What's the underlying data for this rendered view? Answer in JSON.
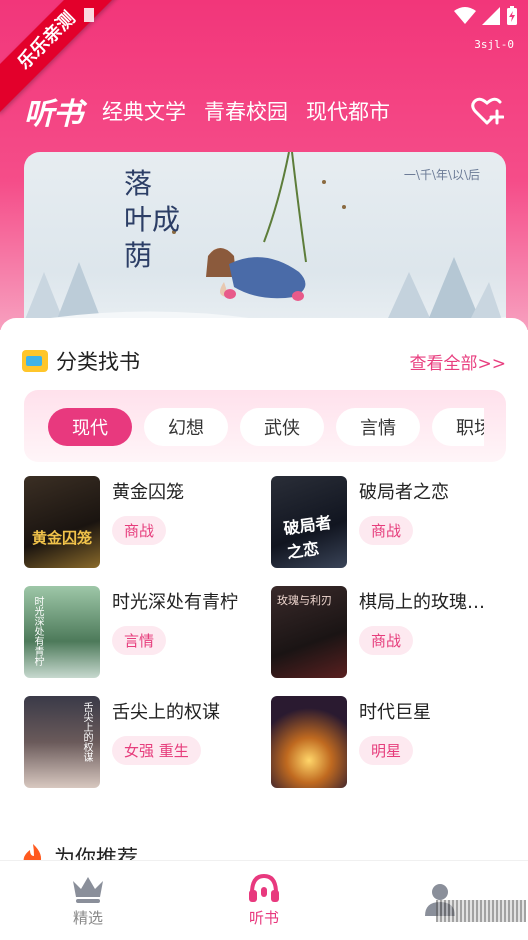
{
  "status_bar": {
    "ribbon_text": "乐乐亲测",
    "device_tag": "3sjl-0"
  },
  "header": {
    "logo": "听书",
    "nav": [
      "经典文学",
      "青春校园",
      "现代都市"
    ],
    "fav_icon": "heart-plus-icon"
  },
  "banner": {
    "title_lines": [
      "落",
      "叶成",
      "荫"
    ],
    "subtitle": "一\\千\\年\\以\\后"
  },
  "category_section": {
    "title": "分类找书",
    "see_all": "查看全部>>",
    "tabs": [
      "现代",
      "幻想",
      "武侠",
      "言情",
      "职场"
    ],
    "active_tab": 0,
    "books": [
      {
        "title": "黄金囚笼",
        "tags": [
          "商战"
        ]
      },
      {
        "title": "破局者之恋",
        "tags": [
          "商战"
        ]
      },
      {
        "title": "时光深处有青柠",
        "tags": [
          "言情"
        ]
      },
      {
        "title": "棋局上的玫瑰…",
        "tags": [
          "商战"
        ]
      },
      {
        "title": "舌尖上的权谋",
        "tags": [
          "女强",
          "重生"
        ]
      },
      {
        "title": "时代巨星",
        "tags": [
          "明星"
        ]
      }
    ]
  },
  "recommend_section": {
    "title": "为你推荐"
  },
  "bottom_nav": [
    {
      "label": "精选",
      "icon": "crown-icon",
      "active": false
    },
    {
      "label": "听书",
      "icon": "headphones-icon",
      "active": true
    },
    {
      "label": "",
      "icon": "user-icon",
      "active": false
    }
  ],
  "colors": {
    "accent": "#e8397e",
    "header_top": "#f2367a",
    "tag_bg": "#fde9f0"
  }
}
